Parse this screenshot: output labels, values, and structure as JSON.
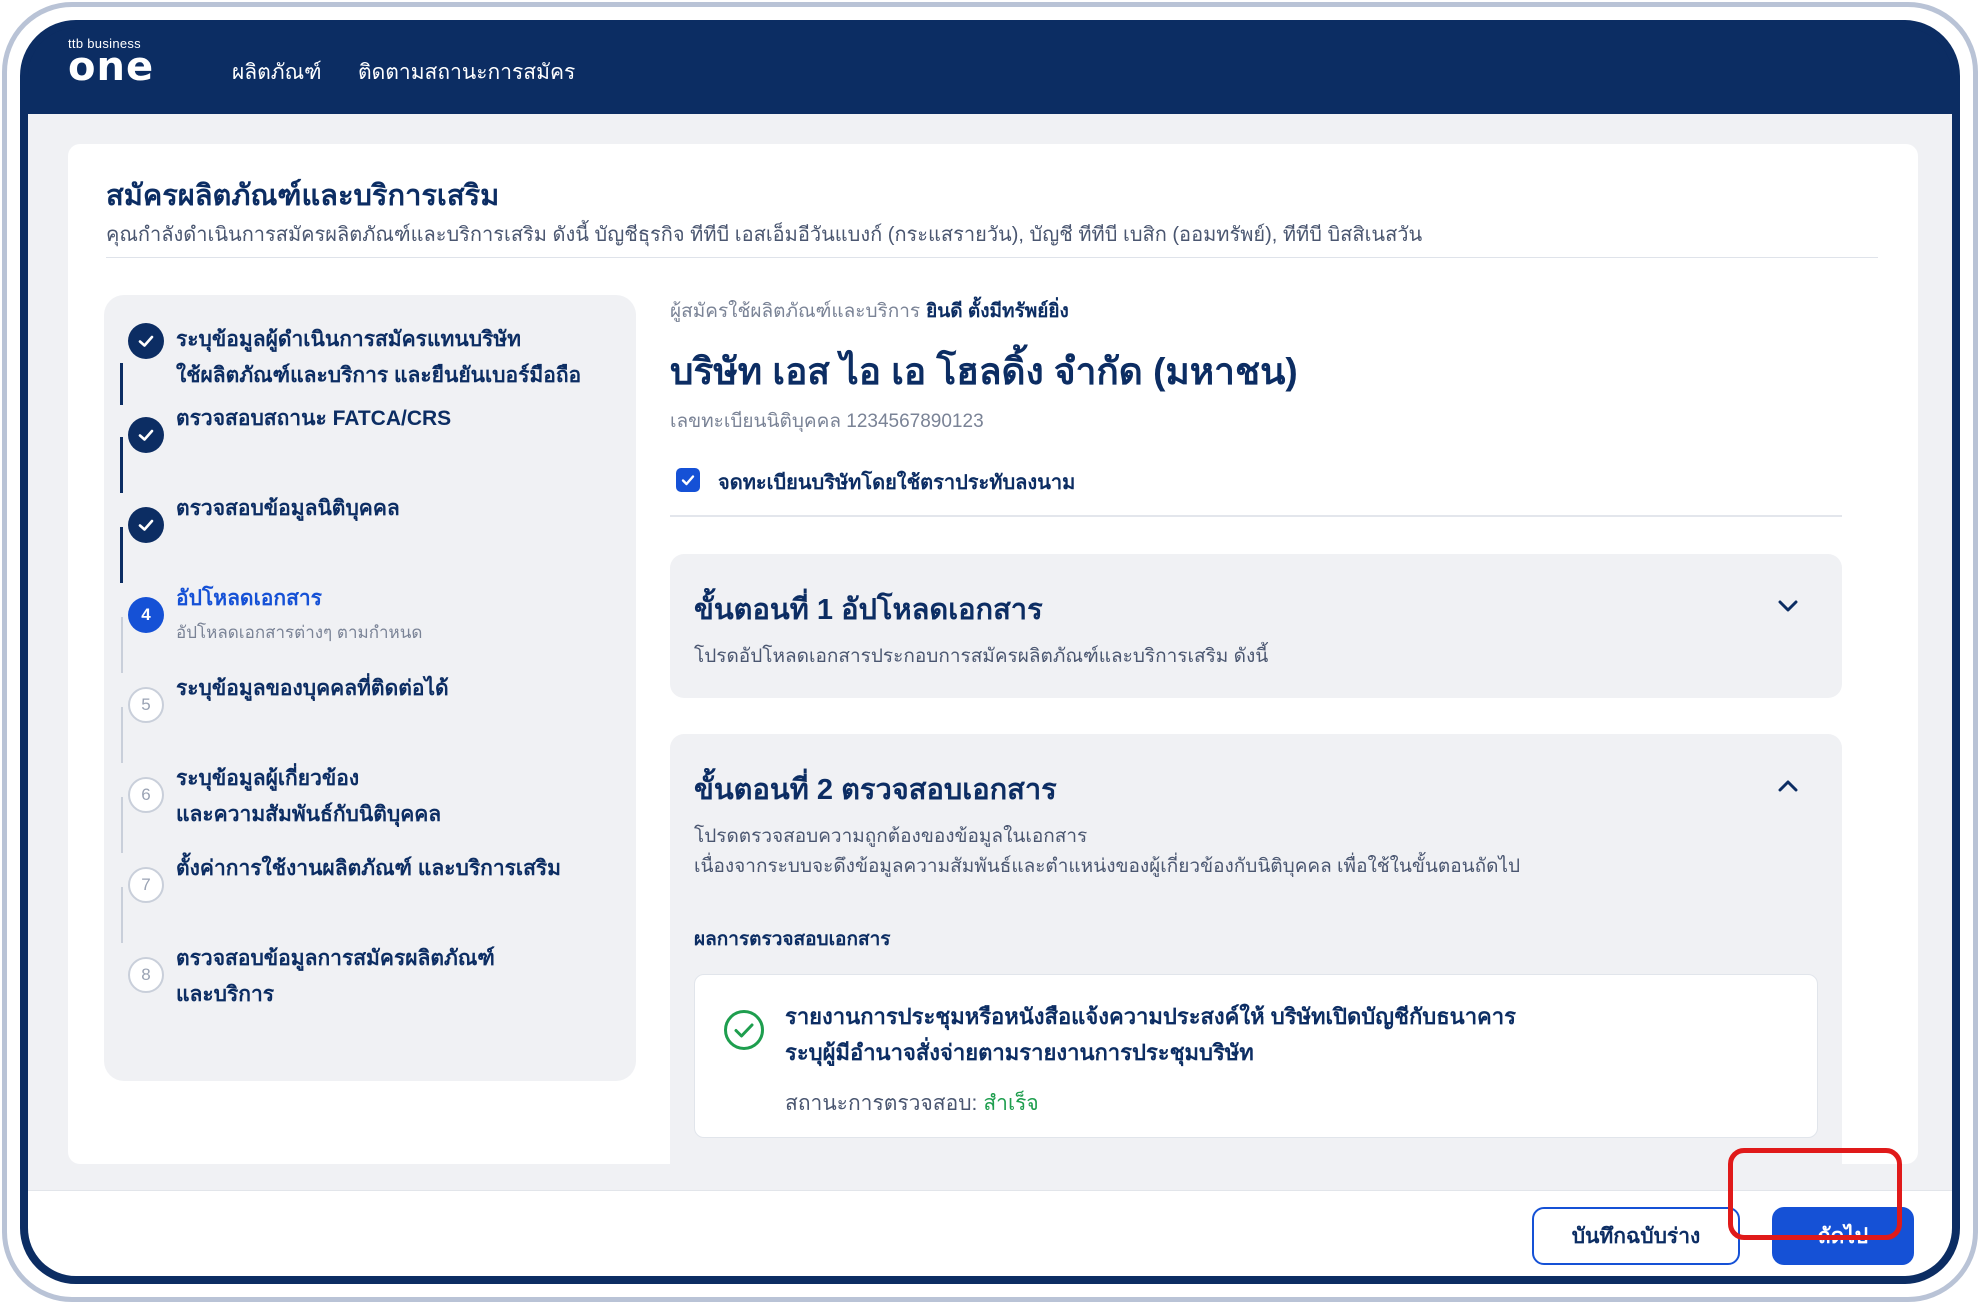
{
  "brand": {
    "small": "ttb business",
    "big": "one"
  },
  "nav": {
    "products": "ผลิตภัณฑ์",
    "track": "ติดตามสถานะการสมัคร"
  },
  "page": {
    "title": "สมัครผลิตภัณฑ์และบริการเสริม",
    "subtitle": "คุณกำลังดำเนินการสมัครผลิตภัณฑ์และบริการเสริม ดังนี้  บัญชีธุรกิจ ทีทีบี เอสเอ็มอีวันแบงก์ (กระแสรายวัน),  บัญชี ทีทีบี เบสิก (ออมทรัพย์),  ทีทีบี บิสสิเนสวัน"
  },
  "steps": [
    {
      "num": "1",
      "state": "done",
      "label1": "ระบุข้อมูลผู้ดำเนินการสมัครแทนบริษัท",
      "label2": "ใช้ผลิตภัณฑ์และบริการ และยืนยันเบอร์มือถือ"
    },
    {
      "num": "2",
      "state": "done",
      "label1": "ตรวจสอบสถานะ FATCA/CRS"
    },
    {
      "num": "3",
      "state": "done",
      "label1": "ตรวจสอบข้อมูลนิติบุคคล"
    },
    {
      "num": "4",
      "state": "active",
      "label1": "อัปโหลดเอกสาร",
      "desc": "อัปโหลดเอกสารต่างๆ ตามกำหนด"
    },
    {
      "num": "5",
      "state": "pending",
      "label1": "ระบุข้อมูลของบุคคลที่ติดต่อได้"
    },
    {
      "num": "6",
      "state": "pending",
      "label1": "ระบุข้อมูลผู้เกี่ยวข้อง",
      "label2": "และความสัมพันธ์กับนิติบุคคล"
    },
    {
      "num": "7",
      "state": "pending",
      "label1": "ตั้งค่าการใช้งานผลิตภัณฑ์ และบริการเสริม"
    },
    {
      "num": "8",
      "state": "pending",
      "label1": "ตรวจสอบข้อมูลการสมัครผลิตภัณฑ์",
      "label2": "และบริการ"
    }
  ],
  "applicant": {
    "label": "ผู้สมัครใช้ผลิตภัณฑ์และบริการ",
    "name": "ยินดี ตั้งมีทรัพย์ยิ่ง"
  },
  "company": {
    "name": "บริษัท เอส ไอ เอ โฮลดิ้ง จำกัด (มหาชน)",
    "reg": "เลขทะเบียนนิติบุคคล 1234567890123"
  },
  "seal_checkbox": {
    "label": "จดทะเบียนบริษัทโดยใช้ตราประทับลงนาม",
    "checked": true
  },
  "step1_panel": {
    "title": "ขั้นตอนที่ 1 อัปโหลดเอกสาร",
    "text": "โปรดอัปโหลดเอกสารประกอบการสมัครผลิตภัณฑ์และบริการเสริม ดังนี้"
  },
  "step2_panel": {
    "title": "ขั้นตอนที่ 2 ตรวจสอบเอกสาร",
    "text1": "โปรดตรวจสอบความถูกต้องของข้อมูลในเอกสาร",
    "text2": "เนื่องจากระบบจะดึงข้อมูลความสัมพันธ์และตำแหน่งของผู้เกี่ยวข้องกับนิติบุคคล เพื่อใช้ในขั้นตอนถัดไป",
    "result_label": "ผลการตรวจสอบเอกสาร",
    "doc_line1": "รายงานการประชุมหรือหนังสือแจ้งความประสงค์ให้ บริษัทเปิดบัญชีกับธนาคาร",
    "doc_line2": "ระบุผู้มีอำนาจสั่งจ่ายตามรายงานการประชุมบริษัท",
    "status_label": "สถานะการตรวจสอบ:",
    "status_value": "สำเร็จ"
  },
  "footer": {
    "draft": "บันทึกฉบับร่าง",
    "next": "ถัดไป"
  },
  "colors": {
    "navy": "#0c2d63",
    "primary": "#1551d6",
    "success": "#1e9e4e",
    "highlight": "#e01a1a"
  }
}
